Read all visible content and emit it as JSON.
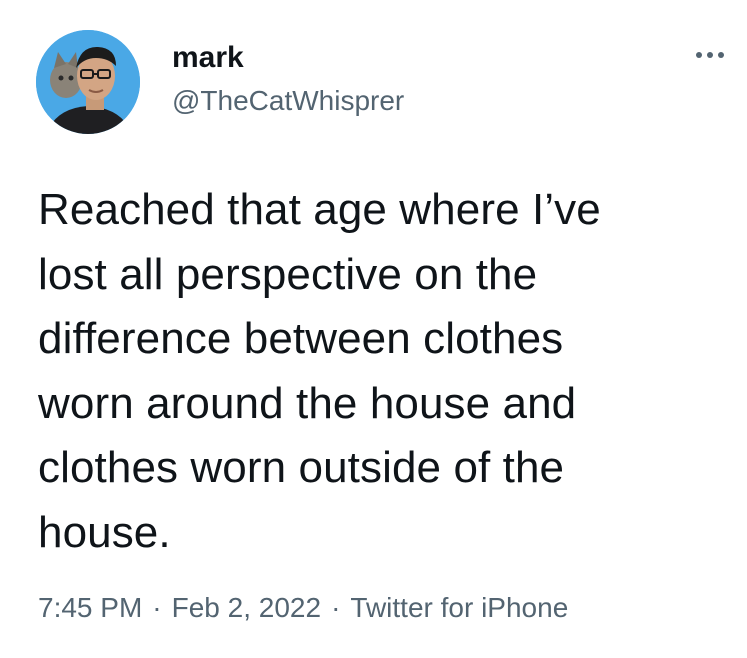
{
  "author": {
    "display_name": "mark",
    "handle": "@TheCatWhisprer",
    "avatar_icon": "profile-photo-avatar"
  },
  "tweet": {
    "text": "Reached that age where I’ve\nlost all perspective on the\ndifference between clothes\nworn around the house and\nclothes worn outside of the\nhouse."
  },
  "meta": {
    "time": "7:45 PM",
    "separator": "·",
    "date": "Feb 2, 2022",
    "source": "Twitter for iPhone"
  },
  "icons": {
    "more": "more-horizontal-icon"
  },
  "colors": {
    "text": "#0f1419",
    "secondary": "#536471",
    "avatar_bg": "#4aa8e6"
  }
}
